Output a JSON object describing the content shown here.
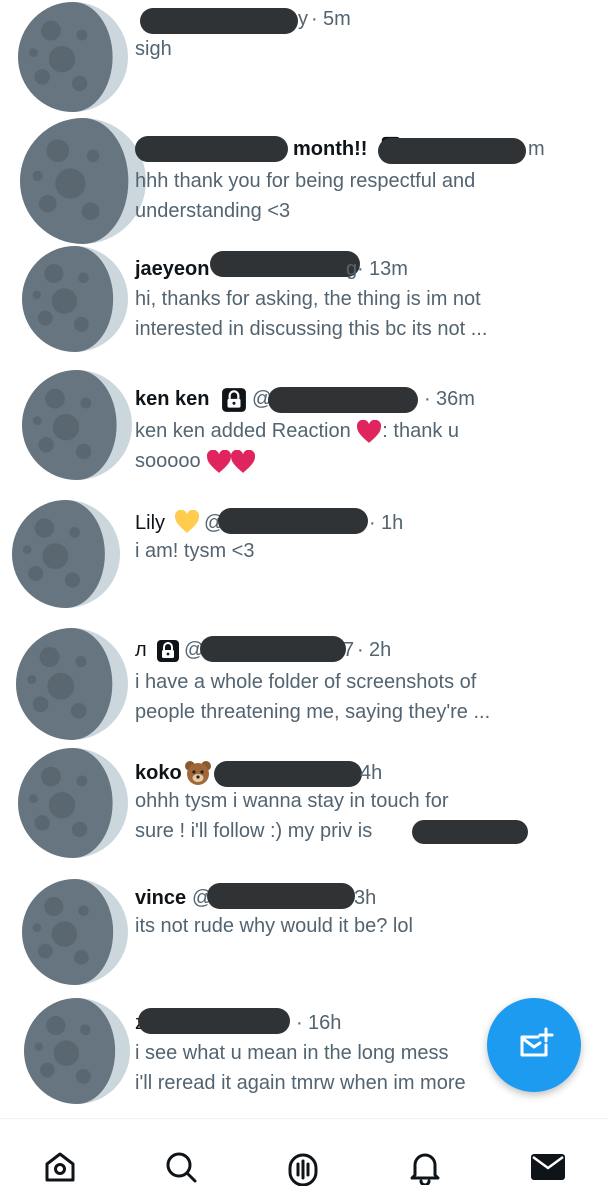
{
  "conversations": [
    {
      "name": "",
      "handle_suffix": "y",
      "time": "5m",
      "preview": "sigh"
    },
    {
      "name": "month!!",
      "time": "m",
      "preview_lines": [
        "hhh thank you for being respectful and",
        "understanding <3"
      ]
    },
    {
      "name": "jaeyeon",
      "handle_suffix": "g",
      "time": "13m",
      "preview_lines": [
        "hi, thanks for asking, the thing is im not",
        "interested in discussing this bc its not ..."
      ]
    },
    {
      "name": "ken ken",
      "handle_prefix": "@",
      "time": "36m",
      "preview_lines": [
        "ken ken added Reaction",
        ": thank u",
        "sooooo"
      ]
    },
    {
      "name": "Lily",
      "handle_prefix": "@",
      "time": "1h",
      "preview": "i am! tysm <3"
    },
    {
      "name": "л",
      "handle_prefix": "@",
      "handle_suffix": "7",
      "time": "2h",
      "preview_lines": [
        "i have a whole folder of screenshots of",
        "people threatening me, saying they're ..."
      ]
    },
    {
      "name": "koko",
      "time": "4h",
      "preview_lines": [
        "ohhh tysm i wanna stay in touch for",
        "sure ! i'll follow :) my priv is"
      ]
    },
    {
      "name": "vince",
      "handle_prefix": "@",
      "time": "3h",
      "preview": "its not rude why would it be? lol"
    },
    {
      "name": "z",
      "time": "16h",
      "preview_lines": [
        "i see what u mean in the long mess",
        "i'll reread it again tmrw when im more"
      ]
    }
  ],
  "separator": "·",
  "icons": {
    "avatar": "moon-icon",
    "lock": "lock-icon",
    "compose": "new-message-icon",
    "tabs": [
      "home-icon",
      "search-icon",
      "spaces-icon",
      "notifications-icon",
      "messages-icon"
    ]
  },
  "colors": {
    "accent": "#1d9bf0",
    "redaction": "#2f3336",
    "text": "#0f1419",
    "secondary": "#536471"
  }
}
